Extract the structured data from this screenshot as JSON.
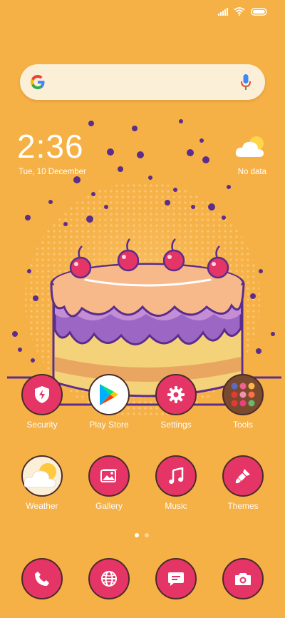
{
  "clock": {
    "time": "2:36",
    "date": "Tue, 10 December"
  },
  "weather_widget": {
    "status": "No data",
    "icon": "cloud-sun-icon"
  },
  "search": {
    "icon": "google-icon",
    "mic": "microphone-icon"
  },
  "apps_row1": [
    {
      "label": "Security",
      "icon": "shield-bolt-icon"
    },
    {
      "label": "Play Store",
      "icon": "play-store-icon"
    },
    {
      "label": "Settings",
      "icon": "gear-icon"
    },
    {
      "label": "Tools",
      "icon": "folder-icon"
    }
  ],
  "apps_row2": [
    {
      "label": "Weather",
      "icon": "weather-icon"
    },
    {
      "label": "Gallery",
      "icon": "gallery-icon"
    },
    {
      "label": "Music",
      "icon": "music-note-icon"
    },
    {
      "label": "Themes",
      "icon": "paintbrush-icon"
    }
  ],
  "dock": [
    {
      "icon": "phone-icon"
    },
    {
      "icon": "browser-icon"
    },
    {
      "icon": "messages-icon"
    },
    {
      "icon": "camera-icon"
    }
  ],
  "page_indicator": {
    "pages": 2,
    "current": 1
  },
  "colors": {
    "background": "#F6B146",
    "icon_bg": "#E43566",
    "outline": "#4A2B2A"
  }
}
